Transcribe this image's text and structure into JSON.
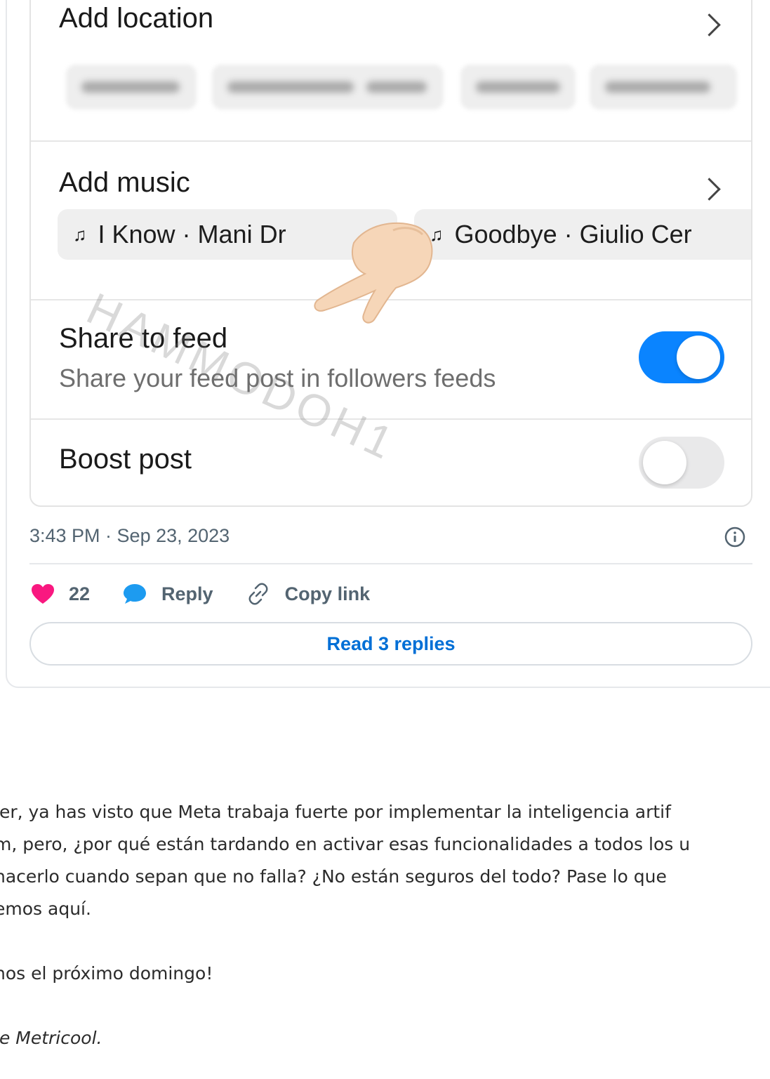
{
  "settings": {
    "add_location_label": "Add location",
    "location_suggestions_blurred": true,
    "add_music_label": "Add music",
    "music_suggestions": [
      "I Know · Mani Dr",
      "Goodbye · Giulio Cer"
    ],
    "music_icon": "music-note-icon",
    "share_to_feed": {
      "title": "Share to feed",
      "subtitle": "Share your feed post in followers feeds",
      "enabled": true
    },
    "boost_post": {
      "title": "Boost post",
      "enabled": false
    },
    "toggle_on_color": "#0a84ff",
    "watermark": "HAMMODOH1"
  },
  "tweet": {
    "timestamp": "3:43 PM · Sep 23, 2023",
    "like_count": "22",
    "reply_label": "Reply",
    "copy_link_label": "Copy link",
    "read_replies_label": "Read 3 replies",
    "like_color": "#f91880",
    "reply_color": "#1d9bf0",
    "link_color": "#006fd6"
  },
  "article": {
    "lines": [
      "ler, ya has visto que Meta trabaja fuerte por implementar la inteligencia artif",
      "m, pero, ¿por qué están tardando en activar esas funcionalidades a todos los u",
      "hacerlo cuando sepan que no falla? ¿No están seguros del todo? Pase lo que",
      "emos aquí.",
      "nos el próximo domingo!",
      "le Metricool."
    ]
  }
}
